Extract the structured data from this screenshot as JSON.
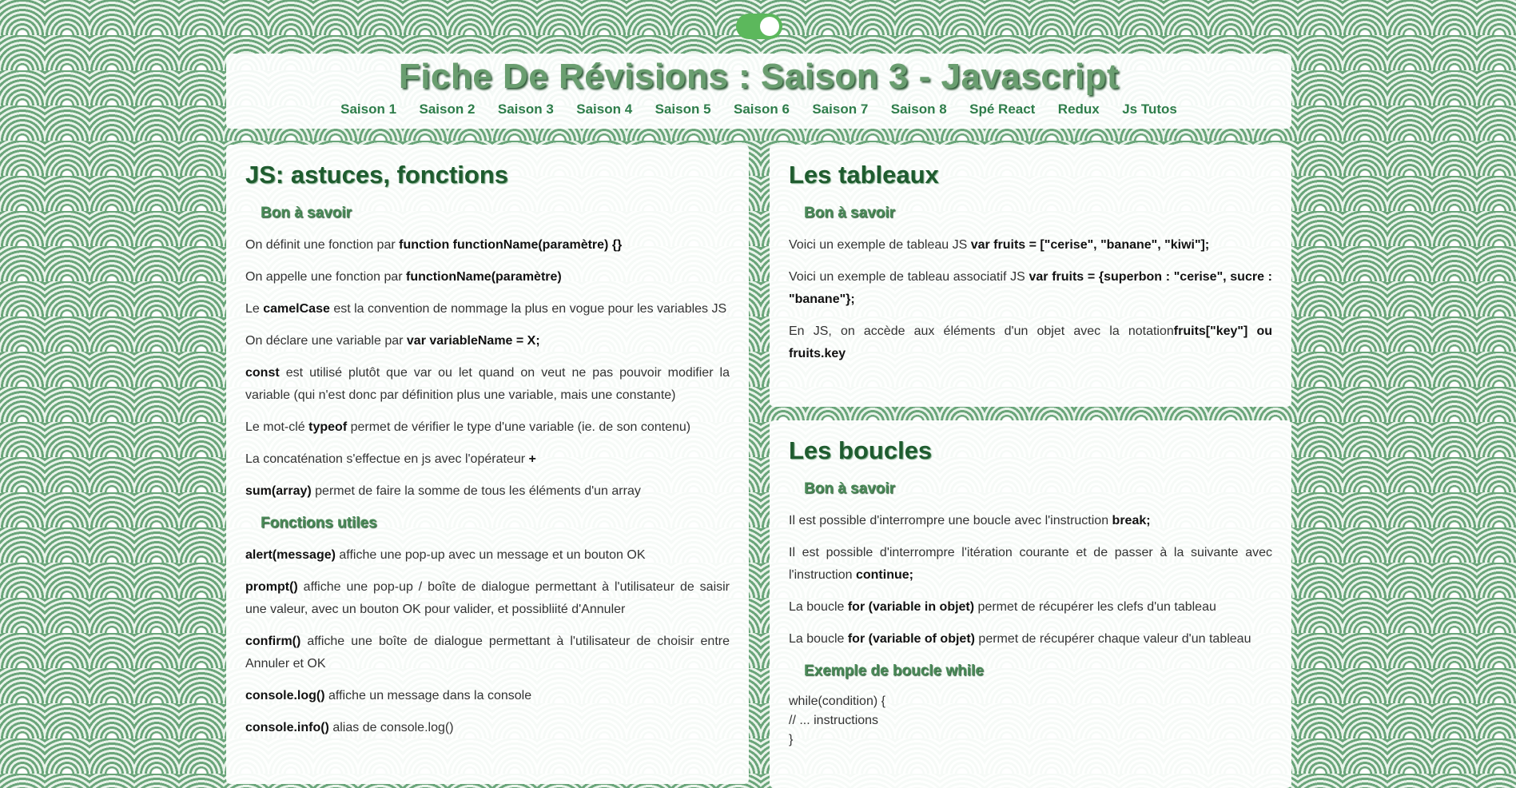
{
  "header": {
    "title": "Fiche De Révisions : Saison 3 - Javascript",
    "nav": [
      "Saison 1",
      "Saison 2",
      "Saison 3",
      "Saison 4",
      "Saison 5",
      "Saison 6",
      "Saison 7",
      "Saison 8",
      "Spé React",
      "Redux",
      "Js Tutos"
    ]
  },
  "card1": {
    "title": "JS: astuces, fonctions",
    "section1": "Bon à savoir",
    "p1": {
      "pre": "On définit une fonction par ",
      "b": "function functionName(paramètre) {}",
      "post": ""
    },
    "p2": {
      "pre": "On appelle une fonction par ",
      "b": "functionName(paramètre)",
      "post": ""
    },
    "p3": {
      "pre": "Le ",
      "b": "camelCase",
      "post": " est la convention de nommage la plus en vogue pour les variables JS"
    },
    "p4": {
      "pre": "On déclare une variable par ",
      "b": "var variableName = X;",
      "post": ""
    },
    "p5": {
      "pre": "",
      "b": "const",
      "post": " est utilisé plutôt que var ou let quand on veut ne pas pouvoir modifier la variable (qui n'est donc par définition plus une variable, mais une constante)"
    },
    "p6": {
      "pre": "Le mot-clé ",
      "b": "typeof",
      "post": " permet de vérifier le type d'une variable (ie. de son contenu)"
    },
    "p7": {
      "pre": "La concaténation s'effectue en js avec l'opérateur ",
      "b": "+",
      "post": ""
    },
    "p8": {
      "pre": "",
      "b": "sum(array)",
      "post": " permet de faire la somme de tous les éléments d'un array"
    },
    "section2": "Fonctions utiles",
    "p9": {
      "pre": "",
      "b": "alert(message)",
      "post": " affiche une pop-up avec un message et un bouton OK"
    },
    "p10": {
      "pre": "",
      "b": "prompt()",
      "post": " affiche une pop-up / boîte de dialogue permettant à l'utilisateur de saisir une valeur, avec un bouton OK pour valider, et possibliité d'Annuler"
    },
    "p11": {
      "pre": "",
      "b": "confirm()",
      "post": " affiche une boîte de dialogue permettant à l'utilisateur de choisir entre Annuler et OK"
    },
    "p12": {
      "pre": "",
      "b": "console.log()",
      "post": " affiche un message dans la console"
    },
    "p13": {
      "pre": "",
      "b": "console.info()",
      "post": " alias de console.log()"
    }
  },
  "card2": {
    "title": "Les tableaux",
    "section1": "Bon à savoir",
    "p1": {
      "pre": "Voici un exemple de tableau JS ",
      "b": "var fruits = [\"cerise\", \"banane\", \"kiwi\"];",
      "post": ""
    },
    "p2": {
      "pre": "Voici un exemple de tableau associatif JS ",
      "b": "var fruits = {superbon : \"cerise\", sucre : \"banane\"};",
      "post": ""
    },
    "p3": {
      "pre": "En JS, on accède aux éléments d'un objet avec la notation",
      "b": "fruits[\"key\"] ou fruits.key",
      "post": ""
    }
  },
  "card3": {
    "title": "Les boucles",
    "section1": "Bon à savoir",
    "p1": {
      "pre": "Il est possible d'interrompre une boucle avec l'instruction ",
      "b": "break;",
      "post": ""
    },
    "p2": {
      "pre": "Il est possible d'interrompre l'itération courante et de passer à la suivante avec l'instruction ",
      "b": "continue;",
      "post": ""
    },
    "p3": {
      "pre": "La boucle ",
      "b": "for (variable in objet)",
      "post": " permet de récupérer les clefs d'un tableau"
    },
    "p4": {
      "pre": "La boucle ",
      "b": "for (variable of objet)",
      "post": " permet de récupérer chaque valeur d'un tableau"
    },
    "section2": "Exemple de boucle while",
    "code": [
      "while(condition) {",
      "// ... instructions",
      "}"
    ]
  }
}
